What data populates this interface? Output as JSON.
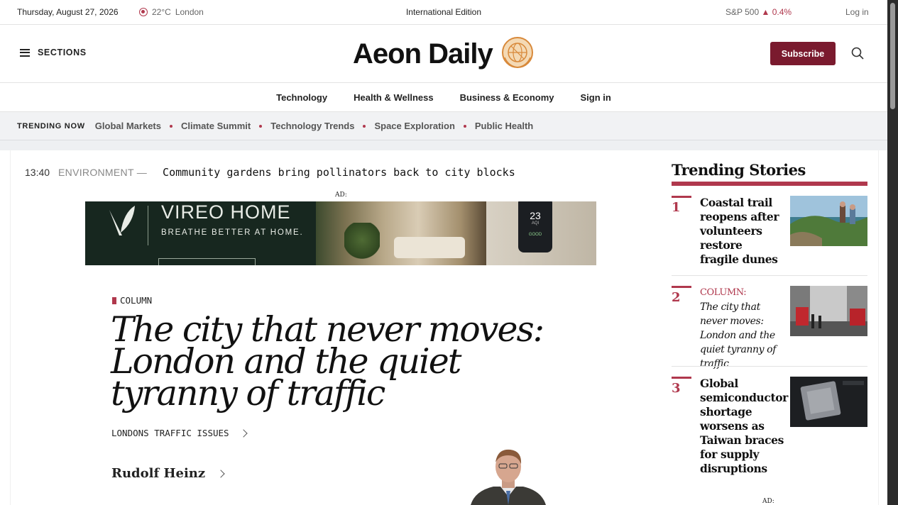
{
  "topbar": {
    "date": "Thursday, August 27, 2026",
    "weather_temp": "22°C",
    "weather_city": "London",
    "edition": "International Edition",
    "market_index": "S&P 500",
    "market_change": "▲ 0.4%",
    "login": "Log in"
  },
  "masthead": {
    "sections_label": "SECTIONS",
    "brand": "Aeon Daily",
    "subscribe_label": "Subscribe"
  },
  "nav": {
    "items": [
      "Technology",
      "Health & Wellness",
      "Business & Economy",
      "Sign in"
    ]
  },
  "trending_bar": {
    "label": "TRENDING NOW",
    "items": [
      "Global Markets",
      "Climate Summit",
      "Technology Trends",
      "Space Exploration",
      "Public Health"
    ]
  },
  "ticker": {
    "time": "13:40",
    "section": "ENVIRONMENT —",
    "headline": "Community gardens bring pollinators back to city blocks"
  },
  "ad_top": {
    "label": "AD:",
    "brand": "VIREO HOME",
    "tagline": "BREATHE BETTER AT HOME.",
    "device_value": "23",
    "device_unit": "AQI",
    "device_status": "GOOD"
  },
  "feature": {
    "kicker": "COLUMN",
    "title": "The city that never moves: London and the quiet tyranny of traffic",
    "topic": "LONDONS TRAFFIC ISSUES",
    "author": "Rudolf Heinz"
  },
  "sidebar": {
    "title": "Trending Stories",
    "stories": [
      {
        "num": "1",
        "kicker": "",
        "title": "Coastal trail reopens after volunteers restore fragile dunes"
      },
      {
        "num": "2",
        "kicker": "COLUMN:",
        "title": "The city that never moves: London and the quiet tyranny of traffic"
      },
      {
        "num": "3",
        "kicker": "",
        "title": "Global semiconductor shortage worsens as Taiwan braces for supply disruptions"
      }
    ],
    "ad_label": "AD:"
  },
  "colors": {
    "accent": "#b0384d",
    "subscribe_bg": "#7a1a2e",
    "ad_bg": "#17271f"
  }
}
